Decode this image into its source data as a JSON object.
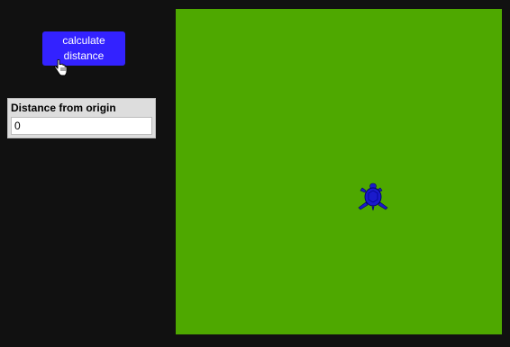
{
  "toolbar": {
    "calculate_label": "calculate distance"
  },
  "readout": {
    "label": "Distance from origin",
    "value": "0"
  },
  "stage": {
    "background_color": "#4ea800"
  },
  "sprite": {
    "icon": "turtle-icon",
    "color": "#1a1acc"
  },
  "colors": {
    "page_background": "#111111",
    "button": "#3322ff"
  }
}
